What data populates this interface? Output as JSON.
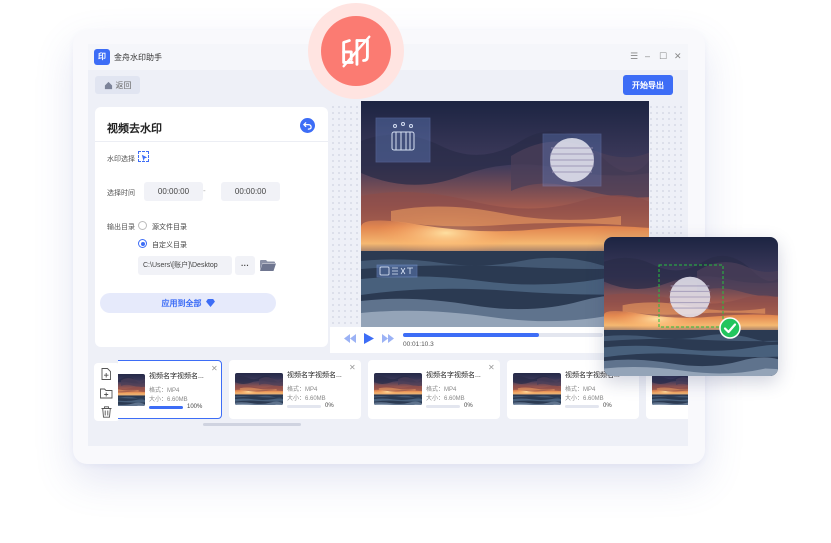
{
  "app": {
    "title": "金舟水印助手",
    "logo_text": "印"
  },
  "window_controls": {
    "menu": "☰",
    "minimize": "–",
    "maximize": "☐",
    "close": "✕"
  },
  "toolbar": {
    "back_label": "返回",
    "export_label": "开始导出"
  },
  "panel": {
    "title": "视频去水印",
    "watermark_select_label": "水印选择",
    "time_label": "选择时间",
    "start_time": "00:00:00",
    "separator": "-",
    "end_time": "00:00:00",
    "output_label": "输出目录",
    "option_source": "源文件目录",
    "option_custom": "自定义目录",
    "custom_selected": true,
    "path_value": "C:\\Users\\[账户]\\Desktop",
    "more_label": "···",
    "apply_label": "应用到全部"
  },
  "player": {
    "current_time": "00:01:10.3",
    "progress": 0.68
  },
  "files": [
    {
      "name": "视频名字视频名...",
      "format": "格式：MP4",
      "size": "大小：6.60MB",
      "progress": 1.0,
      "percent": "100%",
      "active": true
    },
    {
      "name": "视频名字视频名...",
      "format": "格式：MP4",
      "size": "大小：6.60MB",
      "progress": 0.0,
      "percent": "0%",
      "active": false
    },
    {
      "name": "视频名字视频名...",
      "format": "格式：MP4",
      "size": "大小：6.60MB",
      "progress": 0.0,
      "percent": "0%",
      "active": false
    },
    {
      "name": "视频名字视频名...",
      "format": "格式：MP4",
      "size": "大小：6.60MB",
      "progress": 0.0,
      "percent": "0%",
      "active": false
    }
  ],
  "colors": {
    "accent": "#3d6df6",
    "stamp": "#fb7b72",
    "success": "#22c55e"
  },
  "icons": {
    "stamp": "stamp-icon",
    "select": "cursor-select-icon",
    "add_file": "add-file-icon",
    "add_folder": "add-folder-icon",
    "delete": "trash-icon",
    "check": "check-circle-icon"
  }
}
